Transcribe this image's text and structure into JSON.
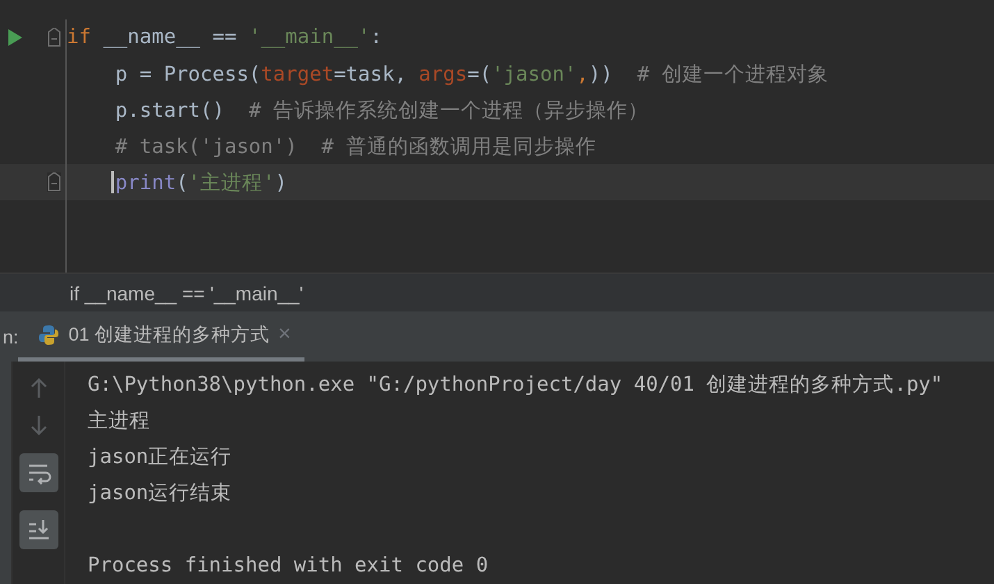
{
  "editor": {
    "lines": [
      {
        "run": true,
        "fold": true,
        "current": false,
        "indent": false,
        "tokens": [
          {
            "kind": "keyword",
            "text": "if"
          },
          {
            "kind": "plain",
            "text": " __name__ == "
          },
          {
            "kind": "string",
            "text": "'__main__'"
          },
          {
            "kind": "plain",
            "text": ":"
          }
        ]
      },
      {
        "run": false,
        "fold": false,
        "current": false,
        "indent": true,
        "tokens": [
          {
            "kind": "plain",
            "text": "p = Process("
          },
          {
            "kind": "param",
            "text": "target"
          },
          {
            "kind": "plain",
            "text": "=task, "
          },
          {
            "kind": "param",
            "text": "args"
          },
          {
            "kind": "plain",
            "text": "=("
          },
          {
            "kind": "string",
            "text": "'jason'"
          },
          {
            "kind": "keyword",
            "text": ","
          },
          {
            "kind": "plain",
            "text": "))  "
          },
          {
            "kind": "comment",
            "text": "# 创建一个进程对象"
          }
        ]
      },
      {
        "run": false,
        "fold": false,
        "current": false,
        "indent": true,
        "tokens": [
          {
            "kind": "plain",
            "text": "p.start()  "
          },
          {
            "kind": "comment",
            "text": "# 告诉操作系统创建一个进程（异步操作）"
          }
        ]
      },
      {
        "run": false,
        "fold": false,
        "current": false,
        "indent": true,
        "tokens": [
          {
            "kind": "comment",
            "text": "# task('jason')  # 普通的函数调用是同步操作"
          }
        ]
      },
      {
        "run": false,
        "fold": true,
        "current": true,
        "indent": true,
        "tokens": [
          {
            "kind": "builtin",
            "text": "print"
          },
          {
            "kind": "plain",
            "text": "("
          },
          {
            "kind": "string",
            "text": "'主进程'"
          },
          {
            "kind": "plain",
            "text": ")"
          }
        ]
      }
    ]
  },
  "breadcrumb": "if __name__ == '__main__'",
  "run_panel": {
    "label": "n:",
    "tabs": [
      {
        "label": "01 创建进程的多种方式",
        "selected": true,
        "close": "×"
      }
    ]
  },
  "console": {
    "lines": [
      "G:\\Python38\\python.exe \"G:/pythonProject/day 40/01 创建进程的多种方式.py\"",
      "主进程",
      "jason正在运行",
      "jason运行结束"
    ],
    "exit_message": "Process finished with exit code 0"
  }
}
